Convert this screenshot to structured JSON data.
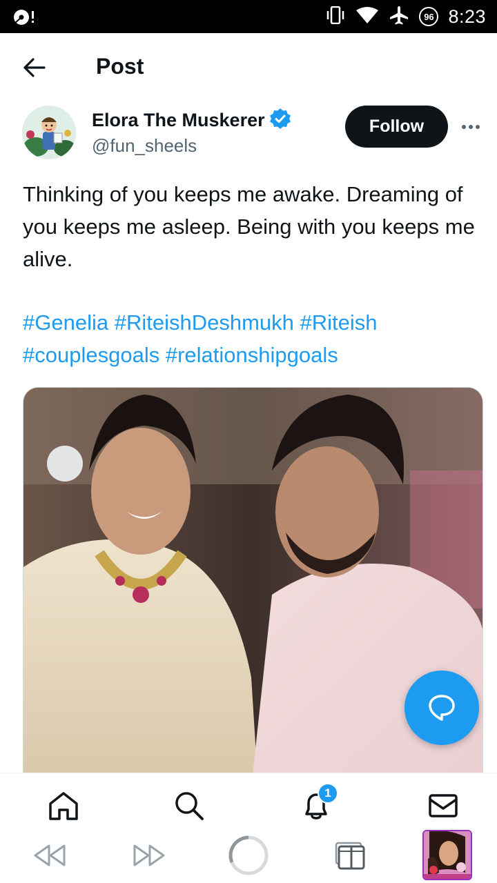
{
  "status_bar": {
    "time": "8:23",
    "battery_badge": "96",
    "icons": [
      "cast-icon",
      "vibrate-icon",
      "wifi-icon",
      "airplane-icon",
      "battery-saver-icon"
    ]
  },
  "header": {
    "title": "Post",
    "back_icon": "back-arrow-icon"
  },
  "author": {
    "name": "Elora The Muskerer",
    "handle": "@fun_sheels",
    "verified": true,
    "verified_color": "#1d9bf0"
  },
  "follow_label": "Follow",
  "post": {
    "text": "Thinking of you keeps me awake. Dreaming of you keeps me asleep. Being with you keeps me alive.",
    "hashtags": [
      "#Genelia",
      "#RiteishDeshmukh",
      "#Riteish",
      "#couplesgoals",
      "#relationshipgoals"
    ]
  },
  "bottom_nav": {
    "items": [
      "home-icon",
      "search-icon",
      "notifications-icon",
      "messages-icon"
    ],
    "notification_count": "1"
  },
  "system_nav": {
    "items": [
      "rewind-icon",
      "fast-forward-icon",
      "home-circle-icon",
      "recent-apps-icon",
      "app-thumbnail"
    ]
  },
  "colors": {
    "accent": "#1d9bf0",
    "text": "#0f1419",
    "secondary_text": "#536471",
    "follow_bg": "#0f1419"
  }
}
